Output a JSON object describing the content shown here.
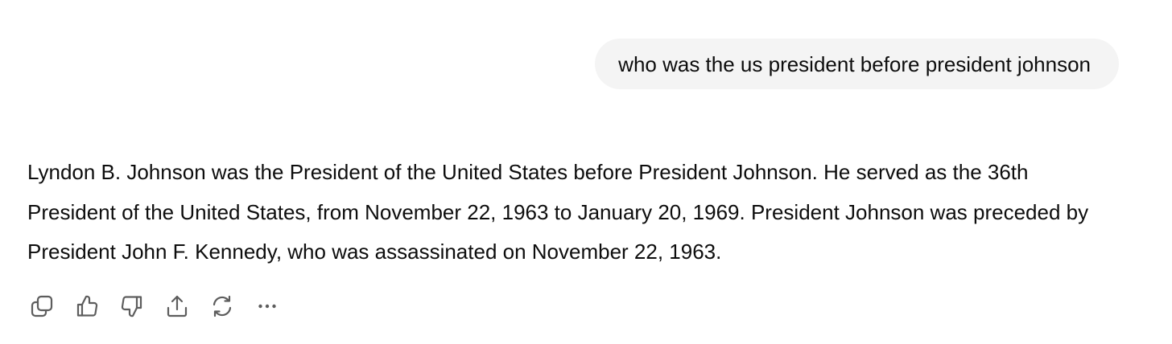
{
  "conversation": {
    "user_message": "who was the us president before president johnson",
    "assistant_message": "Lyndon B. Johnson was the President of the United States before President Johnson. He served as the 36th President of the United States, from November 22, 1963 to January 20, 1969. President Johnson was preceded by President John F. Kennedy, who was assassinated on November 22, 1963."
  },
  "actions": [
    {
      "icon": "copy-icon"
    },
    {
      "icon": "thumbs-up-icon"
    },
    {
      "icon": "thumbs-down-icon"
    },
    {
      "icon": "share-icon"
    },
    {
      "icon": "regenerate-icon"
    },
    {
      "icon": "more-icon"
    }
  ],
  "colors": {
    "text": "#0d0d0d",
    "user_bubble_bg": "#f4f4f4",
    "icon": "#5d5d5d"
  }
}
